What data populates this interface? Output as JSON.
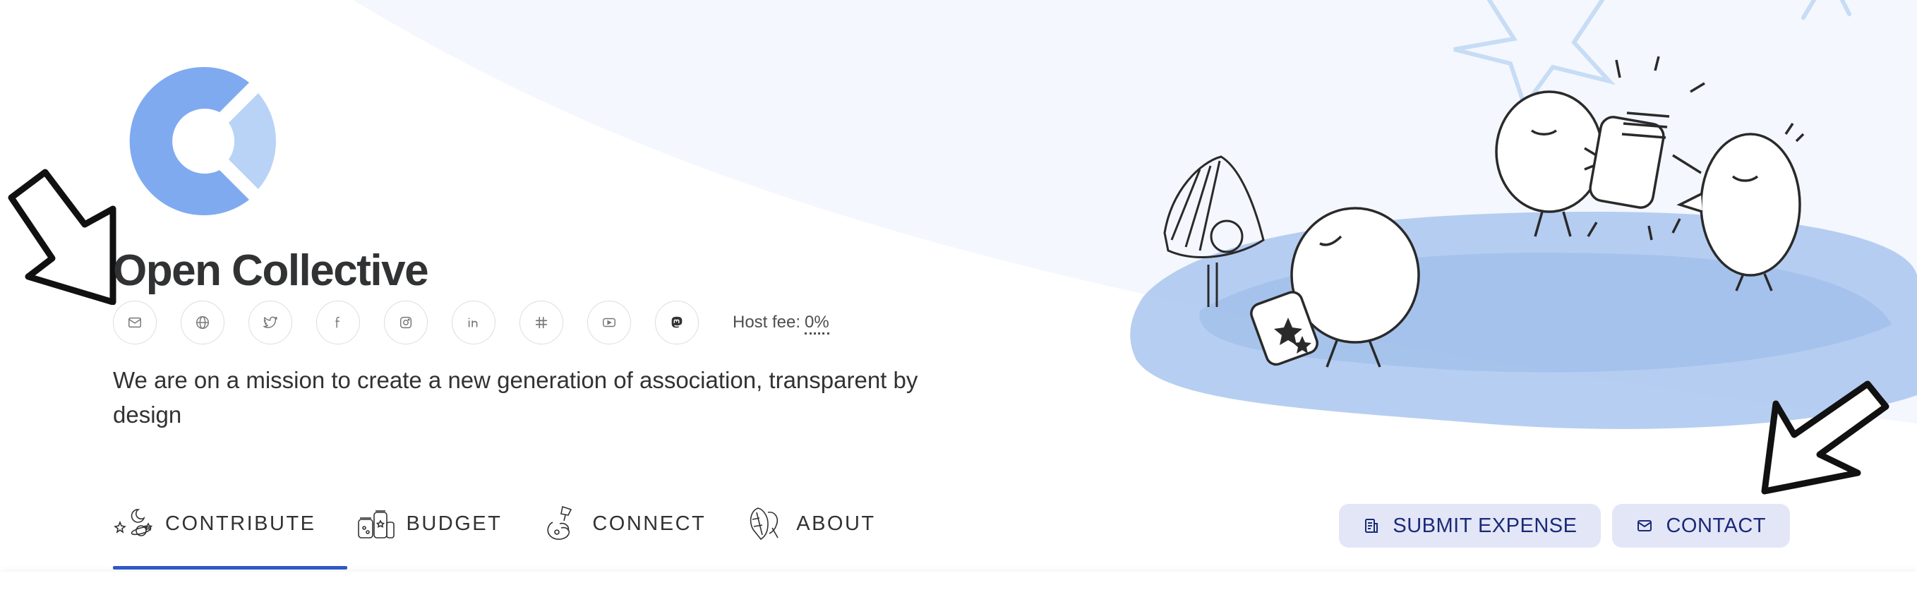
{
  "collective": {
    "name": "Open Collective",
    "description": "We are on a mission to create a new generation of association, transparent by design",
    "host_fee_label": "Host fee:",
    "host_fee_value": "0%"
  },
  "social_links": [
    {
      "icon": "mail-icon"
    },
    {
      "icon": "globe-icon"
    },
    {
      "icon": "twitter-icon"
    },
    {
      "icon": "facebook-icon"
    },
    {
      "icon": "instagram-icon"
    },
    {
      "icon": "linkedin-icon"
    },
    {
      "icon": "slack-icon"
    },
    {
      "icon": "youtube-icon"
    },
    {
      "icon": "mastodon-icon"
    }
  ],
  "tabs": [
    {
      "label": "CONTRIBUTE",
      "icon": "contribute-icon",
      "active": true
    },
    {
      "label": "BUDGET",
      "icon": "budget-icon",
      "active": false
    },
    {
      "label": "CONNECT",
      "icon": "connect-icon",
      "active": false
    },
    {
      "label": "ABOUT",
      "icon": "about-icon",
      "active": false
    }
  ],
  "actions": {
    "submit_expense": "SUBMIT EXPENSE",
    "contact": "CONTACT"
  },
  "colors": {
    "primary": "#3059c9",
    "logo_blue": "#7faaf0",
    "logo_light": "#b8d3f6",
    "button_bg": "#e3e6f7",
    "button_text": "#1a2a77",
    "hero_tint": "#f5f8fe"
  }
}
